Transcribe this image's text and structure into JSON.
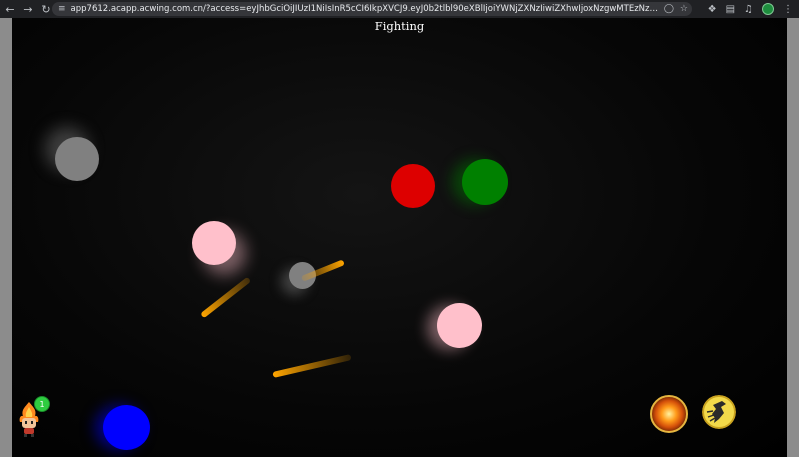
{
  "browser": {
    "back_icon": "back-arrow-icon",
    "forward_icon": "forward-arrow-icon",
    "reload_icon": "reload-icon",
    "url": "app7612.acapp.acwing.com.cn/?access=eyJhbGciOiJIUzI1NiIsInR5cCI6IkpXVCJ9.eyJ0b2tlbl90eXBlIjoiYWNjZXNzIiwiZXhwIjoxNzgwMTEzNzQzLCJqdGkiOiJjYjE3ODAxMTM0NDMsImp0aSI6I..."
  },
  "game": {
    "title": "Fighting",
    "avatar_badge": "1",
    "skills": [
      "fireball-skill-icon",
      "blink-skill-icon"
    ]
  },
  "colors": {
    "gray_ball": "#808080",
    "pink_ball": "#ffc0cb",
    "red_ball": "#dd0000",
    "green_ball": "#008000",
    "blue_ball": "#0000ff",
    "projectile": "#ffa500"
  }
}
